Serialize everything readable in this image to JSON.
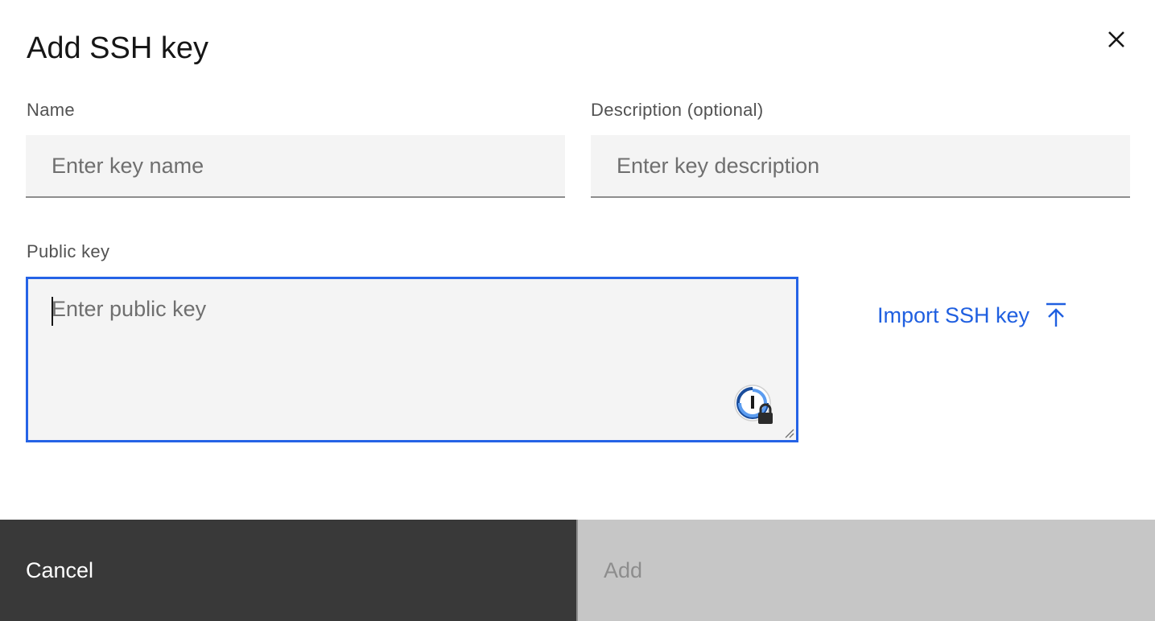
{
  "modal": {
    "title": "Add SSH key",
    "close_icon": "close-icon"
  },
  "fields": {
    "name": {
      "label": "Name",
      "value": "",
      "placeholder": "Enter key name"
    },
    "description": {
      "label": "Description (optional)",
      "value": "",
      "placeholder": "Enter key description"
    },
    "public_key": {
      "label": "Public key",
      "value": "",
      "placeholder": "Enter public key",
      "password_manager_icon": "password-manager-icon"
    }
  },
  "import": {
    "label": "Import SSH key",
    "icon": "upload-icon"
  },
  "footer": {
    "cancel_label": "Cancel",
    "add_label": "Add"
  },
  "colors": {
    "accent": "#2563e6",
    "link": "#1f5fe0",
    "cancel_bg": "#393939",
    "add_disabled_bg": "#c6c6c6",
    "field_bg": "#f4f4f4"
  }
}
